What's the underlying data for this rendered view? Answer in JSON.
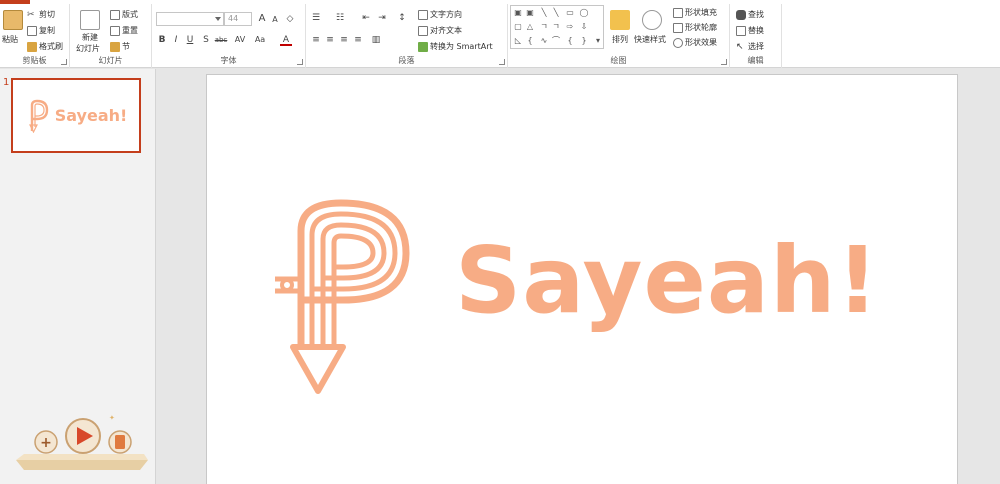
{
  "colors": {
    "accent": "#c43e1c",
    "brand": "#f7ac85",
    "ribbon_bg": "#ffffff",
    "canvas_bg": "#e6e6e6"
  },
  "clipboard": {
    "paste": "粘贴",
    "cut": "剪切",
    "copy": "复制",
    "format_painter": "格式刷",
    "label": "剪贴板"
  },
  "slides_group": {
    "new_slide_line1": "新建",
    "new_slide_line2": "幻灯片",
    "layout": "版式",
    "reset": "重置",
    "section": "节",
    "label": "幻灯片"
  },
  "font": {
    "size": "44",
    "grow": "A",
    "shrink": "A",
    "bold": "B",
    "italic": "I",
    "underline": "U",
    "strike": "S",
    "shadow": "abc",
    "spacing": "AV",
    "case": "Aa",
    "color": "A",
    "label": "字体"
  },
  "paragraph": {
    "text_direction": "文字方向",
    "align_text": "对齐文本",
    "smartart": "转换为 SmartArt",
    "label": "段落"
  },
  "drawing": {
    "arrange": "排列",
    "quick_styles": "快速样式",
    "shape_fill": "形状填充",
    "shape_outline": "形状轮廓",
    "shape_effects": "形状效果",
    "label": "绘图"
  },
  "editing": {
    "find": "查找",
    "replace": "替换",
    "select": "选择",
    "label": "编辑"
  },
  "thumbnail": {
    "number": "1",
    "text": "Sayeah!"
  },
  "slide": {
    "logo_text": "Sayeah!"
  }
}
